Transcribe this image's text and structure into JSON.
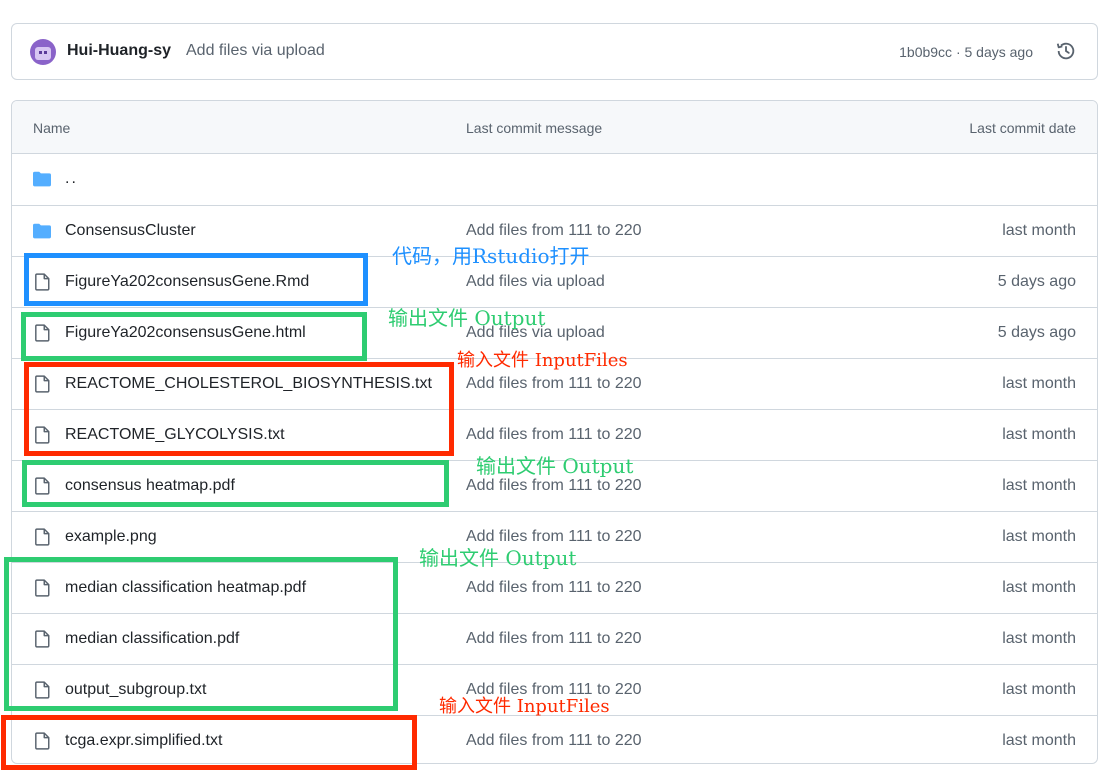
{
  "commit": {
    "author": "Hui-Huang-sy",
    "message": "Add files via upload",
    "meta": "1b0b9cc · 5 days ago"
  },
  "table": {
    "headers": {
      "name": "Name",
      "message": "Last commit message",
      "date": "Last commit date"
    },
    "parent": "..",
    "rows": [
      {
        "name": "ConsensusCluster",
        "message": "Add files from 111 to 220",
        "date": "last month",
        "icon": "folder-icon"
      },
      {
        "name": "FigureYa202consensusGene.Rmd",
        "message": "Add files via upload",
        "date": "5 days ago",
        "icon": "file-icon"
      },
      {
        "name": "FigureYa202consensusGene.html",
        "message": "Add files via upload",
        "date": "5 days ago",
        "icon": "file-icon"
      },
      {
        "name": "REACTOME_CHOLESTEROL_BIOSYNTHESIS.txt",
        "message": "Add files from 111 to 220",
        "date": "last month",
        "icon": "file-icon"
      },
      {
        "name": "REACTOME_GLYCOLYSIS.txt",
        "message": "Add files from 111 to 220",
        "date": "last month",
        "icon": "file-icon"
      },
      {
        "name": "consensus heatmap.pdf",
        "message": "Add files from 111 to 220",
        "date": "last month",
        "icon": "file-icon"
      },
      {
        "name": "example.png",
        "message": "Add files from 111 to 220",
        "date": "last month",
        "icon": "file-icon"
      },
      {
        "name": "median classification heatmap.pdf",
        "message": "Add files from 111 to 220",
        "date": "last month",
        "icon": "file-icon"
      },
      {
        "name": "median classification.pdf",
        "message": "Add files from 111 to 220",
        "date": "last month",
        "icon": "file-icon"
      },
      {
        "name": "output_subgroup.txt",
        "message": "Add files from 111 to 220",
        "date": "last month",
        "icon": "file-icon"
      },
      {
        "name": "tcga.expr.simplified.txt",
        "message": "Add files from 111 to 220",
        "date": "last month",
        "icon": "file-icon"
      }
    ]
  },
  "annotations": [
    {
      "text": "代码，用Rstudio打开",
      "color": "#1e90ff"
    },
    {
      "text": "输出文件 Output",
      "color": "#2ecc71"
    },
    {
      "text": "输入文件 InputFiles",
      "color": "#ff2a00"
    },
    {
      "text": "输出文件 Output",
      "color": "#2ecc71"
    },
    {
      "text": "输出文件 Output",
      "color": "#2ecc71"
    },
    {
      "text": "输入文件 InputFiles",
      "color": "#ff2a00"
    }
  ],
  "colors": {
    "folder": "#54aeff",
    "border": "#d0d7de",
    "header_bg": "#f6f8fa",
    "muted_text": "#59636e",
    "annotation_blue": "#1e90ff",
    "annotation_green": "#2ecc71",
    "annotation_red": "#ff2a00"
  }
}
